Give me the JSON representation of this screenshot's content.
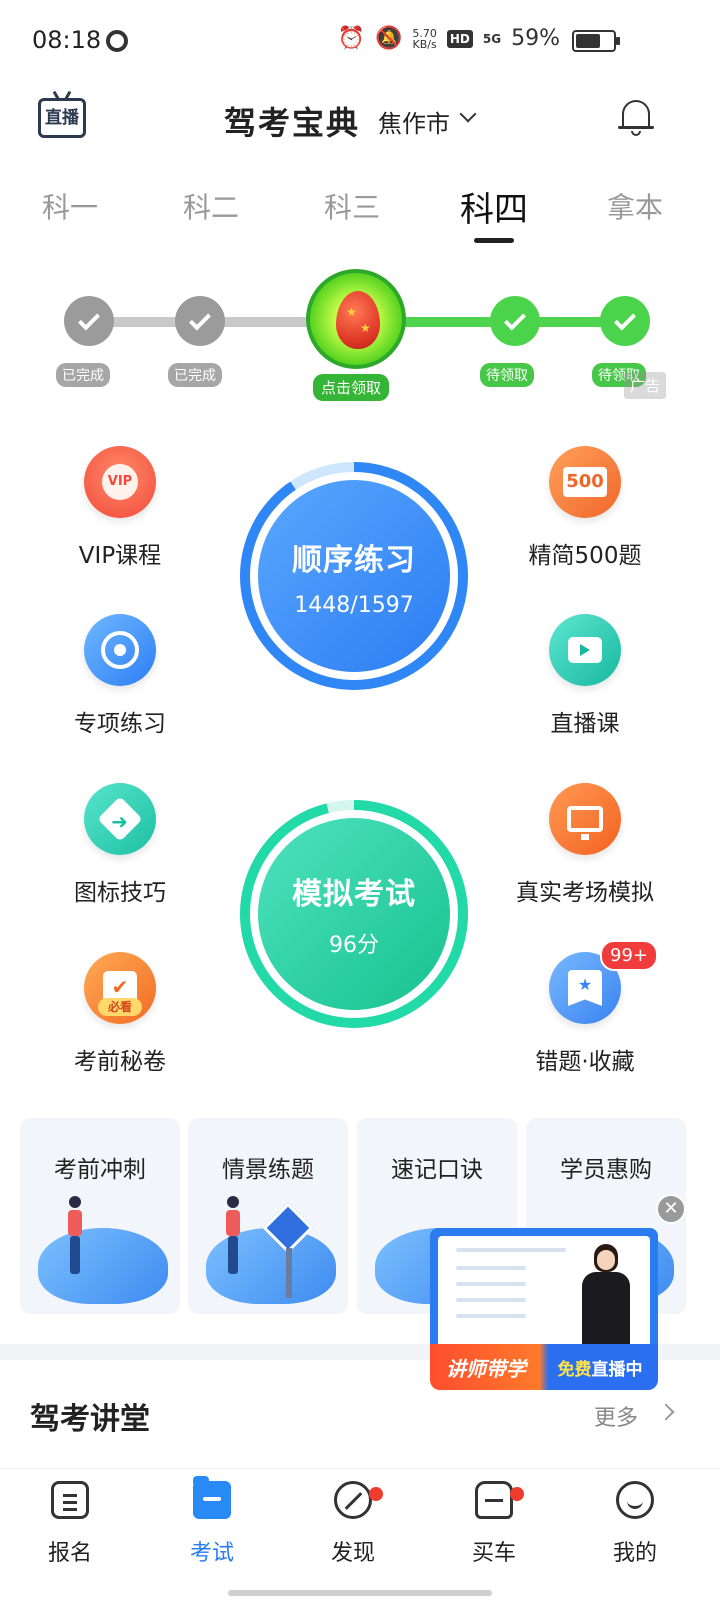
{
  "status_bar": {
    "time": "08:18",
    "net_speed_value": "5.70",
    "net_speed_unit": "KB/s",
    "hd": "HD",
    "network": "5G",
    "battery": "59%"
  },
  "header": {
    "live_label": "直播",
    "title": "驾考宝典",
    "city": "焦作市"
  },
  "tabs": [
    {
      "label": "科一"
    },
    {
      "label": "科二"
    },
    {
      "label": "科三"
    },
    {
      "label": "科四",
      "active": true
    },
    {
      "label": "拿本"
    }
  ],
  "reward_steps": [
    {
      "label": "已完成",
      "state": "done"
    },
    {
      "label": "已完成",
      "state": "done"
    },
    {
      "label": "点击领取",
      "state": "claim"
    },
    {
      "label": "待领取",
      "state": "pending"
    },
    {
      "label": "待领取",
      "state": "pending"
    }
  ],
  "ad_label": "广告",
  "features_left": [
    {
      "label": "VIP课程",
      "icon": "vip-medal-icon",
      "icon_text": "VIP"
    },
    {
      "label": "专项练习",
      "icon": "target-icon"
    },
    {
      "label": "图标技巧",
      "icon": "road-sign-icon"
    },
    {
      "label": "考前秘卷",
      "icon": "exam-paper-icon",
      "icon_badge": "必看"
    }
  ],
  "features_right": [
    {
      "label": "精简500题",
      "icon": "500-board-icon",
      "icon_text": "500"
    },
    {
      "label": "直播课",
      "icon": "video-camera-icon"
    },
    {
      "label": "真实考场模拟",
      "icon": "monitor-icon"
    },
    {
      "label": "错题·收藏",
      "icon": "bookmark-star-icon",
      "badge": "99+"
    }
  ],
  "sequential_practice": {
    "title": "顺序练习",
    "progress_text": "1448/1597",
    "done": 1448,
    "total": 1597
  },
  "mock_exam": {
    "title": "模拟考试",
    "score_text": "96分",
    "score": 96
  },
  "cards": [
    {
      "label": "考前冲刺"
    },
    {
      "label": "情景练题"
    },
    {
      "label": "速记口诀"
    },
    {
      "label": "学员惠购"
    }
  ],
  "floating_live": {
    "left_text": "讲师带学",
    "right_text_1": "免费",
    "right_text_2": "直播中"
  },
  "lecture": {
    "title": "驾考讲堂",
    "more": "更多"
  },
  "bottom_nav": [
    {
      "label": "报名",
      "icon": "form-icon"
    },
    {
      "label": "考试",
      "icon": "folder-icon",
      "active": true
    },
    {
      "label": "发现",
      "icon": "compass-icon",
      "dot": true
    },
    {
      "label": "买车",
      "icon": "car-icon",
      "dot": true
    },
    {
      "label": "我的",
      "icon": "smile-icon"
    }
  ],
  "colors": {
    "accent_blue": "#2a7cf0",
    "accent_green": "#17c28e",
    "reward_green": "#4cd34c",
    "badge_red": "#f03c3c"
  }
}
